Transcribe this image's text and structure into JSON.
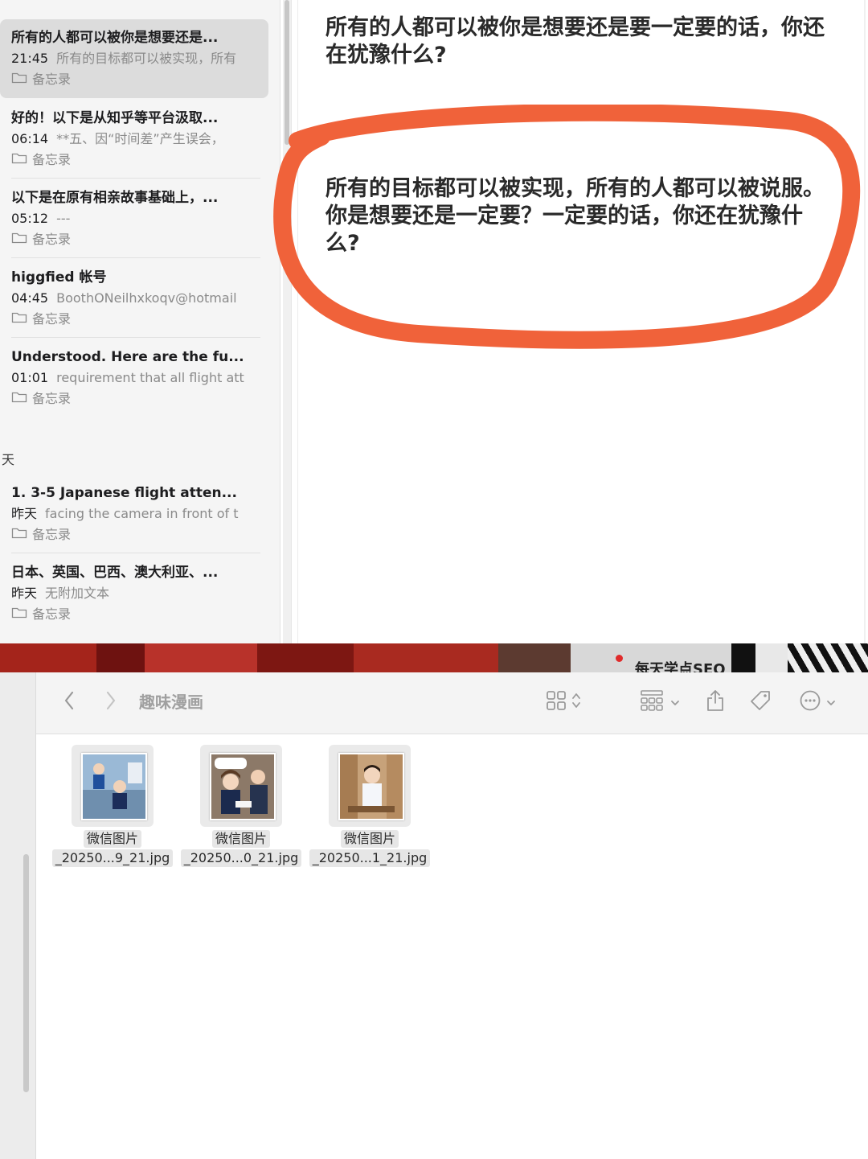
{
  "notes": {
    "items": [
      {
        "title": "所有的人都可以被你是想要还是...",
        "time": "21:45",
        "preview": "所有的目标都可以被实现，所有",
        "folder": "备忘录",
        "selected": true
      },
      {
        "title": "好的！以下是从知乎等平台汲取...",
        "time": "06:14",
        "preview": "**五、因“时间差”产生误会，",
        "folder": "备忘录",
        "selected": false
      },
      {
        "title": "以下是在原有相亲故事基础上，...",
        "time": "05:12",
        "preview": "---",
        "folder": "备忘录",
        "selected": false
      },
      {
        "title": "higgfied 帐号",
        "time": "04:45",
        "preview": "BoothONeilhxkoqv@hotmail",
        "folder": "备忘录",
        "selected": false
      },
      {
        "title": "Understood. Here are the fu...",
        "time": "01:01",
        "preview": "requirement that all flight att",
        "folder": "备忘录",
        "selected": false
      }
    ],
    "section_label": "天",
    "yesterday_items": [
      {
        "title": "1. 3-5 Japanese flight atten...",
        "time": "昨天",
        "preview": "facing the camera in front of t",
        "folder": "备忘录"
      },
      {
        "title": "日本、英国、巴西、澳大利亚、...",
        "time": "昨天",
        "preview": "无附加文本",
        "folder": "备忘录"
      }
    ]
  },
  "editor": {
    "paragraph1": "所有的人都可以被你是想要还是要一定要的话，你还在犹豫什么?",
    "paragraph2": "所有的目标都可以被实现，所有的人都可以被说服。你是想要还是一定要？一定要的话，你还在犹豫什么?",
    "circle_color": "#f0623a"
  },
  "background_strip": {
    "text": "每天学点SEO"
  },
  "finder": {
    "folder_title": "趣味漫画",
    "icons": [
      "back-icon",
      "forward-icon",
      "grid-view-icon",
      "group-icon",
      "share-icon",
      "tag-icon",
      "more-icon"
    ],
    "files": [
      {
        "line1": "微信图片",
        "line2": "_20250...9_21.jpg"
      },
      {
        "line1": "微信图片",
        "line2": "_20250...0_21.jpg"
      },
      {
        "line1": "微信图片",
        "line2": "_20250...1_21.jpg"
      }
    ]
  }
}
